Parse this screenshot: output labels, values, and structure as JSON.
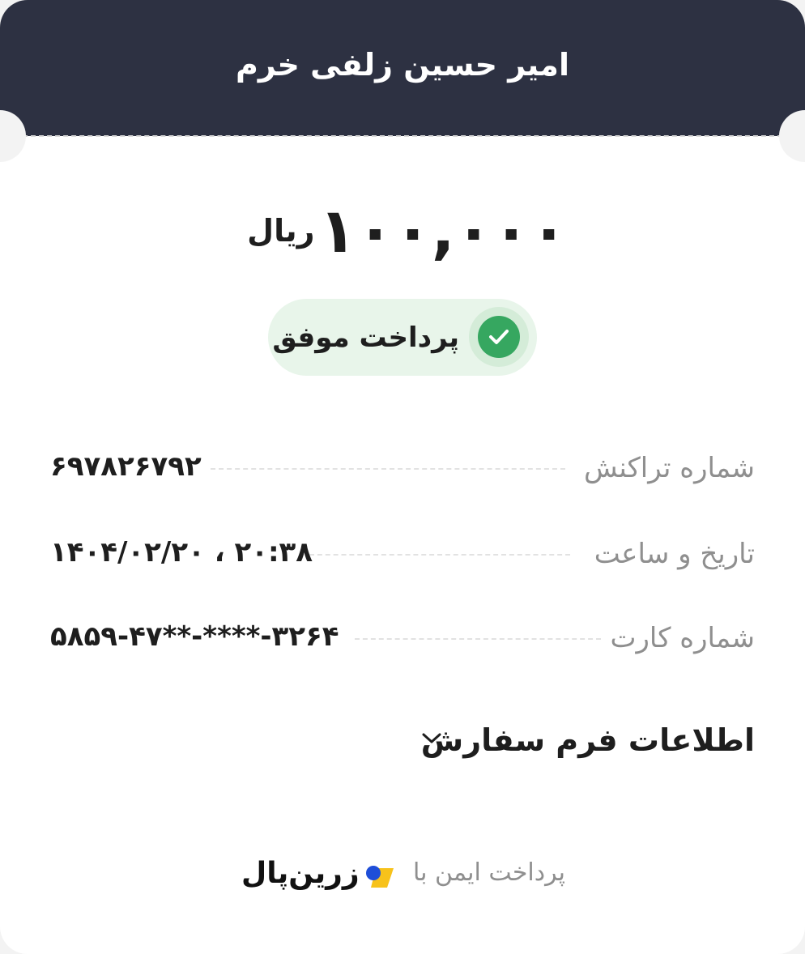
{
  "header": {
    "title": "امیر حسین زلفی خرم"
  },
  "payment": {
    "amount": "۱۰۰,۰۰۰",
    "currency": "ریال",
    "status": "پرداخت موفق",
    "status_color": "#36a760"
  },
  "details": [
    {
      "label": "شماره تراکنش",
      "value": "۶۹۷۸۲۶۷۹۲"
    },
    {
      "label": "تاریخ و ساعت",
      "value": "۱۴۰۴/۰۲/۲۰ ، ۲۰:۳۸"
    },
    {
      "label": "شماره کارت",
      "value": "۵۸۵۹-۴۷**-****-۳۲۶۴"
    }
  ],
  "order_form": {
    "label": "اطلاعات فرم سفارش",
    "icon": "chevron-down-icon"
  },
  "footer": {
    "secure_text": "پرداخت ایمن با",
    "brand": "زرین‌پال",
    "brand_colors": {
      "blue": "#1e4ed8",
      "yellow": "#f7c21b"
    }
  },
  "colors": {
    "header_bg": "#2d3142",
    "card_bg": "#ffffff",
    "label_gray": "#8f8f8f"
  }
}
